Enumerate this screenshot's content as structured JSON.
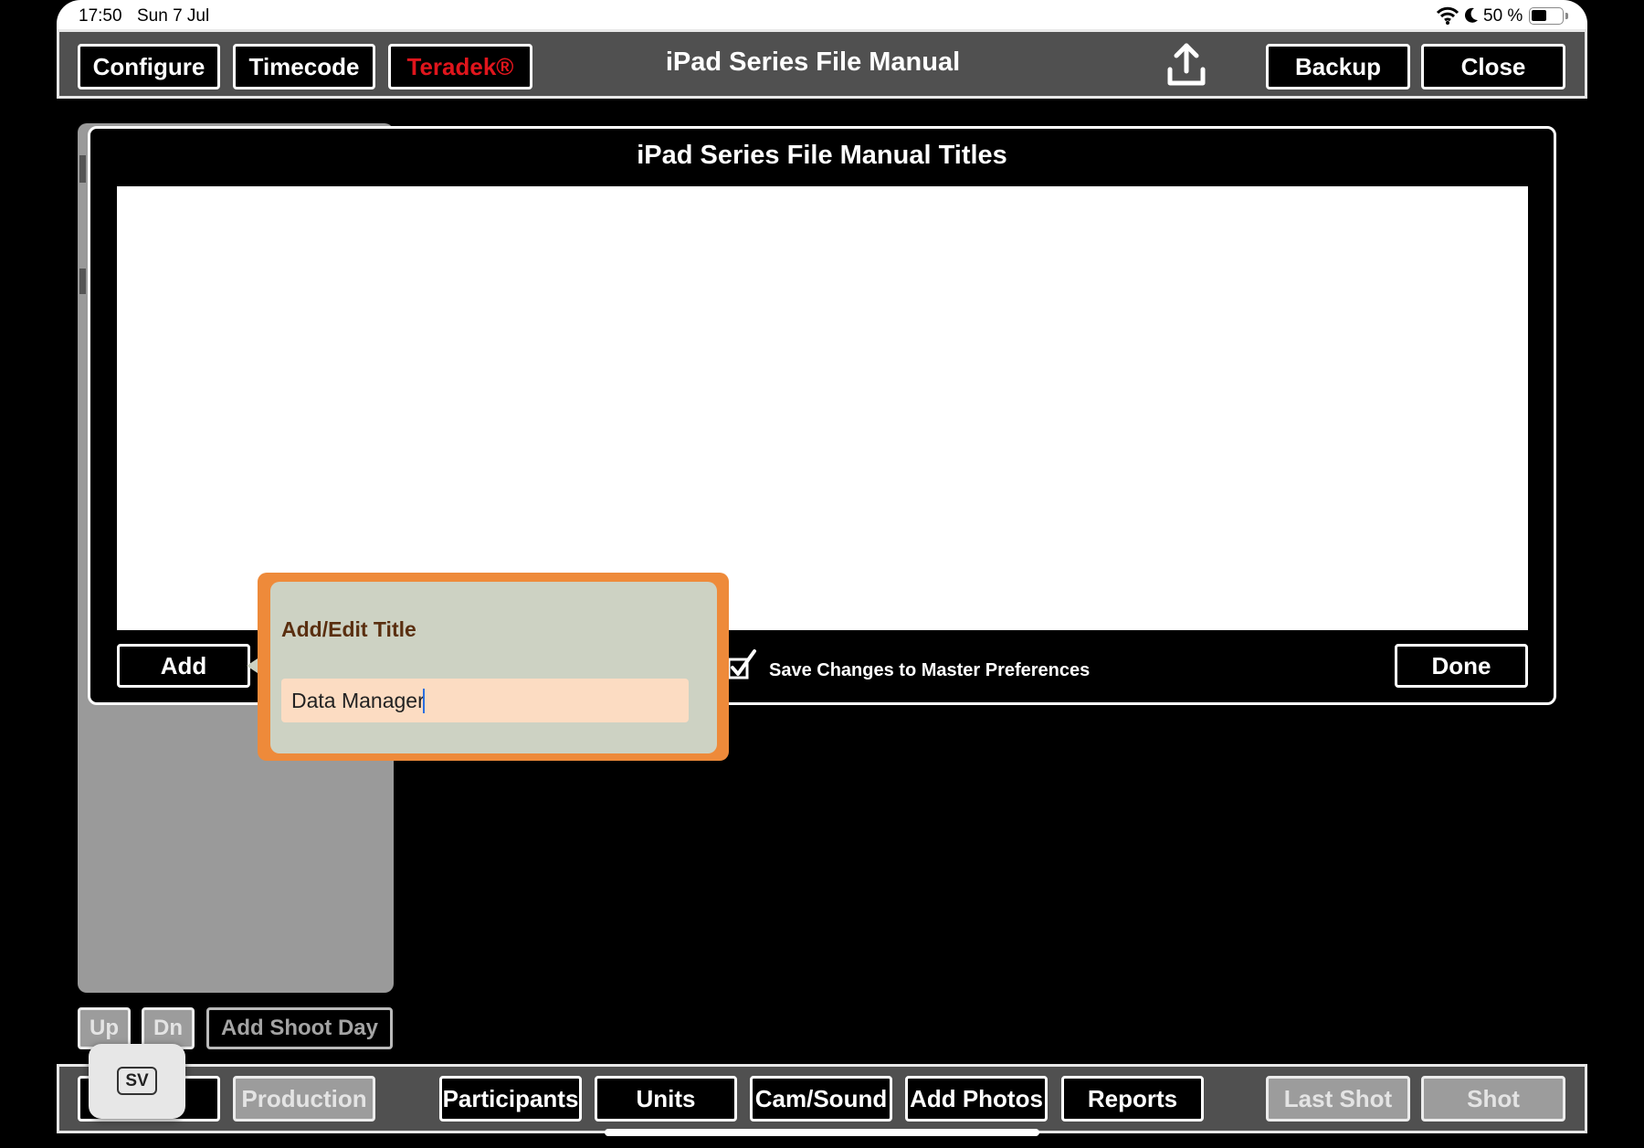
{
  "status_bar": {
    "time": "17:50",
    "date": "Sun 7 Jul",
    "battery_text": "50 %",
    "battery_level": 0.5
  },
  "top_toolbar": {
    "configure": "Configure",
    "timecode": "Timecode",
    "teradek": "Teradek®",
    "title": "iPad Series File Manual",
    "upload_icon": "share-upload-icon",
    "backup": "Backup",
    "close": "Close"
  },
  "modal": {
    "title": "iPad Series File Manual Titles",
    "add": "Add",
    "done": "Done",
    "save_label": "Save Changes to Master Preferences",
    "save_checked": true
  },
  "popover": {
    "title": "Add/Edit Title",
    "input_value": "Data Manager"
  },
  "left_panel": {
    "up": "Up",
    "dn": "Dn",
    "add_shoot_day": "Add Shoot Day"
  },
  "bottom_toolbar": {
    "production": "Production",
    "participants": "Participants",
    "units": "Units",
    "cam_sound": "Cam/Sound",
    "add_photos": "Add Photos",
    "reports": "Reports",
    "last_shot": "Last Shot",
    "shot": "Shot"
  },
  "floating_widget": {
    "label": "SV"
  },
  "colors": {
    "toolbar_bg": "#505050",
    "teradek_red": "#e0151c",
    "popover_border": "#ee8a3a",
    "popover_bg": "#cdd2c3",
    "input_bg": "#fcdcc2",
    "caret": "#2b6fe0"
  }
}
